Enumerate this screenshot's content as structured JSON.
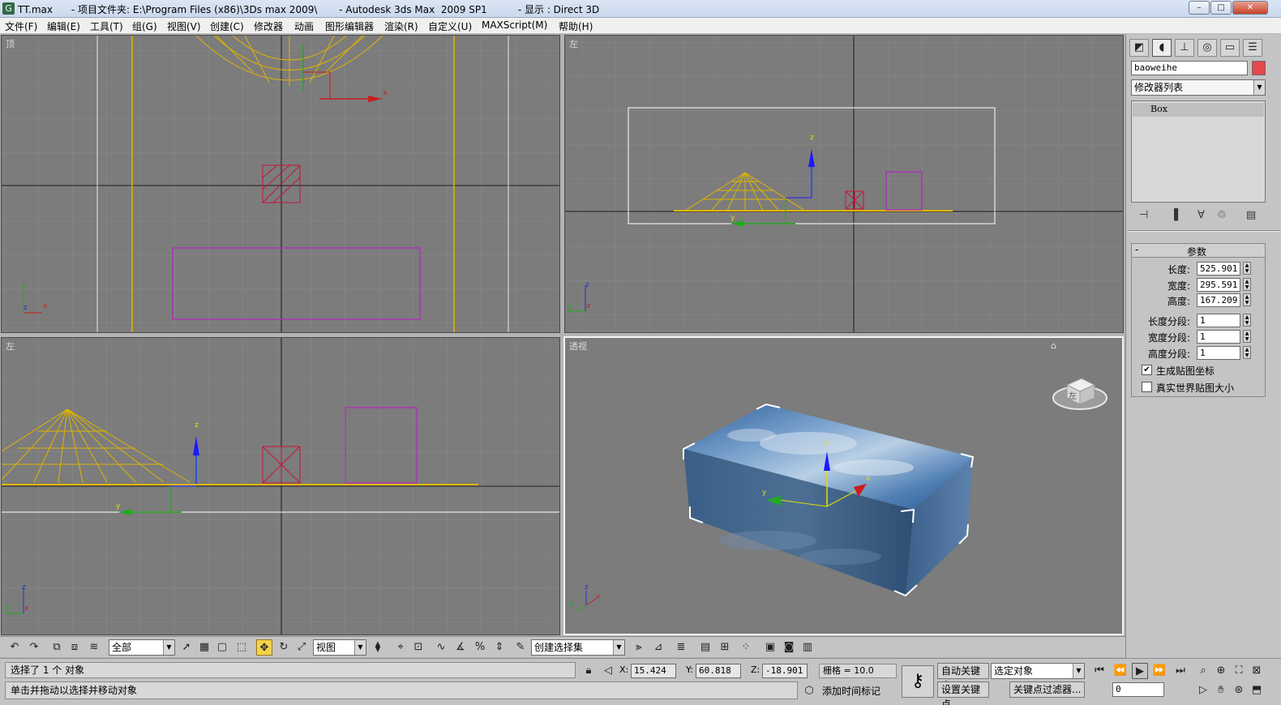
{
  "window": {
    "title": "TT.max      - 项目文件夹: E:\\Program Files (x86)\\3Ds max 2009\\       - Autodesk 3ds Max  2009 SP1          - 显示 : Direct 3D",
    "app_icon": "3ds-max-icon",
    "controls": [
      "–",
      "□",
      "✕"
    ]
  },
  "menu": [
    "文件(F)",
    "编辑(E)",
    "工具(T)",
    "组(G)",
    "视图(V)",
    "创建(C)",
    "修改器",
    "动画",
    "图形编辑器",
    "渲染(R)",
    "自定义(U)",
    "MAXScript(M)",
    "帮助(H)"
  ],
  "viewports": {
    "top": {
      "label": "顶"
    },
    "left": {
      "label": "左"
    },
    "front": {
      "label": "左"
    },
    "perspective": {
      "label": "透视"
    },
    "gizmo_labels": {
      "x": "x",
      "y": "y",
      "z": "z"
    },
    "viewcube_face": "左"
  },
  "command_panel": {
    "tabs": [
      "create-tab-icon",
      "modify-tab-icon",
      "hierarchy-tab-icon",
      "motion-tab-icon",
      "display-tab-icon",
      "utilities-tab-icon"
    ],
    "object_name": "baoweihe",
    "object_color": "#e5484d",
    "modifier_list": "修改器列表",
    "stack_item": "Box",
    "rollout_title": "参数",
    "rollout_collapse": "-",
    "params": [
      {
        "label": "长度:",
        "value": "525.901"
      },
      {
        "label": "宽度:",
        "value": "295.591"
      },
      {
        "label": "高度:",
        "value": "167.209"
      },
      {
        "label": "长度分段:",
        "value": "1"
      },
      {
        "label": "宽度分段:",
        "value": "1"
      },
      {
        "label": "高度分段:",
        "value": "1"
      }
    ],
    "checkboxes": [
      {
        "label": "生成贴图坐标",
        "checked": true,
        "mark": "✔"
      },
      {
        "label": "真实世界贴图大小",
        "checked": false,
        "mark": ""
      }
    ]
  },
  "toolbar": {
    "selection_filter": "全部",
    "ref_coord": "视图",
    "named_selection": "创建选择集"
  },
  "status": {
    "selection": "选择了 1 个 对象",
    "prompt": "单击并拖动以选择并移动对象",
    "x_label": "X:",
    "x": "15.424",
    "y_label": "Y:",
    "y": "60.818",
    "z_label": "Z:",
    "z": "-18.901",
    "grid": "栅格 = 10.0",
    "auto_key": "自动关键点",
    "set_key": "设置关键点",
    "key_filter_combo": "选定对象",
    "key_filters": "关键点过滤器...",
    "add_time_tag": "添加时间标记",
    "frame": "0"
  },
  "colors": {
    "viewport_bg": "#7c7c7c",
    "grid_line": "#8a8a8a",
    "axis_line": "#1a1a1a",
    "box_wire": "#c8143c",
    "cone_wire": "#e0b400",
    "plane_wire": "#b428c0",
    "selection_bracket": "#ffffff"
  }
}
